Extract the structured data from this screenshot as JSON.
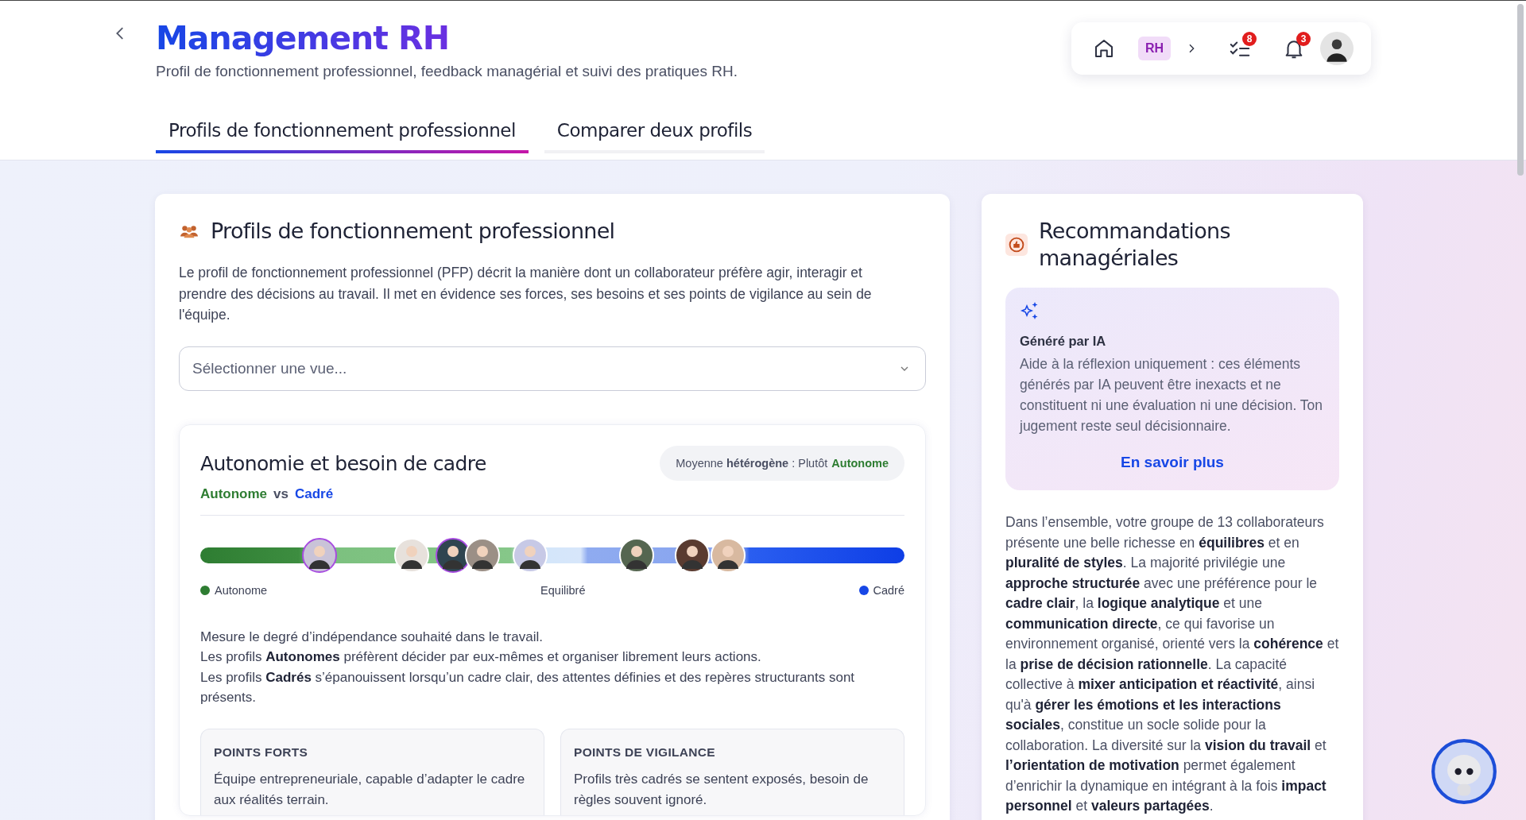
{
  "header": {
    "title": "Management RH",
    "subtitle": "Profil de fonctionnement professionnel, feedback managérial et suivi des pratiques RH.",
    "badge": "RH",
    "tasks_count": "8",
    "notifications_count": "3"
  },
  "tabs": [
    {
      "label": "Profils de fonctionnement professionnel",
      "selected": true
    },
    {
      "label": "Comparer deux profils",
      "selected": false
    }
  ],
  "profiles_card": {
    "title": "Profils de fonctionnement professionnel",
    "description": "Le profil de fonctionnement professionnel (PFP) décrit la manière dont un collaborateur préfère agir, interagir et prendre des décisions au travail. Il met en évidence ses forces, ses besoins et ses points de vigilance au sein de l'équipe.",
    "view_select": {
      "placeholder": "Sélectionner une vue..."
    },
    "dimension": {
      "title": "Autonomie et besoin de cadre",
      "left_label": "Autonome",
      "vs": "vs",
      "right_label": "Cadré",
      "summary": "Moyenne **hétérogène** : Plutôt",
      "summary_value": "Autonome",
      "avatars": [
        {
          "level": 0.169,
          "highlighted": true
        },
        {
          "level": 0.3,
          "highlighted": false
        },
        {
          "level": 0.359,
          "highlighted": true
        },
        {
          "level": 0.401,
          "highlighted": false
        },
        {
          "level": 0.468,
          "highlighted": false
        },
        {
          "level": 0.62,
          "highlighted": false
        },
        {
          "level": 0.699,
          "highlighted": false
        },
        {
          "level": 0.749,
          "highlighted": false
        }
      ],
      "scale": {
        "left": "Autonome",
        "middle": "Equilibré",
        "right": "Cadré"
      },
      "explanation": [
        "Mesure le degré d’indépendance souhaité dans le travail.",
        "Les profils **Autonomes** préfèrent décider par eux-mêmes et organiser librement leurs actions.",
        "Les profils **Cadrés** s’épanouissent lorsqu’un cadre clair, des attentes définies et des repères structurants sont présents."
      ],
      "panels": [
        {
          "title": "POINTS FORTS",
          "text": "Équipe entrepreneuriale, capable d’adapter le cadre aux réalités terrain."
        },
        {
          "title": "POINTS DE VIGILANCE",
          "text": "Profils très cadrés se sentent exposés, besoin de règles souvent ignoré."
        }
      ]
    }
  },
  "recommendations": {
    "title": "Recommandations managériales",
    "ai_notice": {
      "title": "Généré par IA",
      "text": "Aide à la réflexion uniquement : ces éléments générés par IA peuvent être inexacts et ne constituent ni une évaluation ni une décision. Ton jugement reste seul décisionnaire.",
      "link": "En savoir plus"
    },
    "summary": "Dans l’ensemble, votre groupe de 13 collaborateurs présente une belle richesse en **équilibres** et en **pluralité de styles**. La majorité privilégie une **approche structurée** avec une préférence pour le **cadre clair**, la **logique analytique** et une **communication directe**, ce qui favorise un environnement organisé, orienté vers la **cohérence** et la **prise de décision rationnelle**. La capacité collective à **mixer anticipation et réactivité**, ainsi qu'à **gérer les émotions et les interactions sociales**, constitue un socle solide pour la collaboration. La diversité sur la **vision du travail** et **l’orientation de motivation** permet également d’enrichir la dynamique en intégrant à la fois **impact personnel** et **valeurs partagées**."
  }
}
